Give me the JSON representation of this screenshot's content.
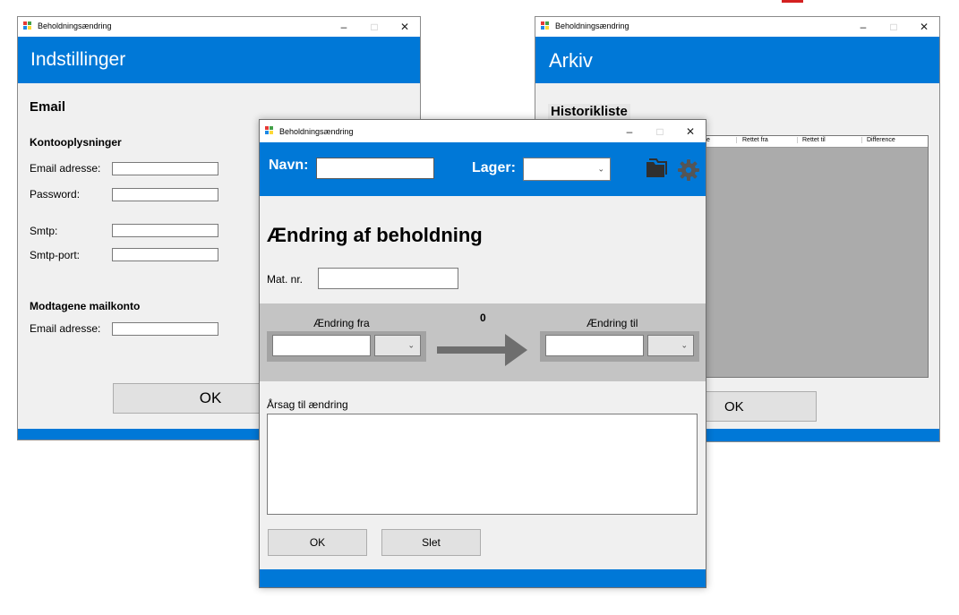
{
  "window_title": "Beholdningsændring",
  "settings": {
    "banner_title": "Indstillinger",
    "section_email": "Email",
    "account_heading": "Kontooplysninger",
    "email_label": "Email adresse:",
    "password_label": "Password:",
    "smtp_label": "Smtp:",
    "smtp_port_label": "Smtp-port:",
    "received_heading": "Modtagene mailkonto",
    "received_email_label": "Email adresse:",
    "ok_label": "OK"
  },
  "archive": {
    "banner_title": "Arkiv",
    "history_label": "Historikliste",
    "columns": [
      "e",
      "Rettet fra",
      "Rettet til",
      "Difference"
    ],
    "ok_label": "OK"
  },
  "main": {
    "name_label": "Navn:",
    "storage_label": "Lager:",
    "heading": "Ændring af beholdning",
    "mat_label": "Mat. nr.",
    "change_from_label": "Ændring fra",
    "change_to_label": "Ændring til",
    "difference_value": "0",
    "reason_label": "Årsag til ændring",
    "ok_label": "OK",
    "delete_label": "Slet"
  },
  "titlebar": {
    "minimize": "–",
    "maximize": "□",
    "close": "✕"
  },
  "colors": {
    "accent": "#0078d7",
    "panel_gray": "#c4c4c4",
    "grid_gray": "#ababab"
  }
}
